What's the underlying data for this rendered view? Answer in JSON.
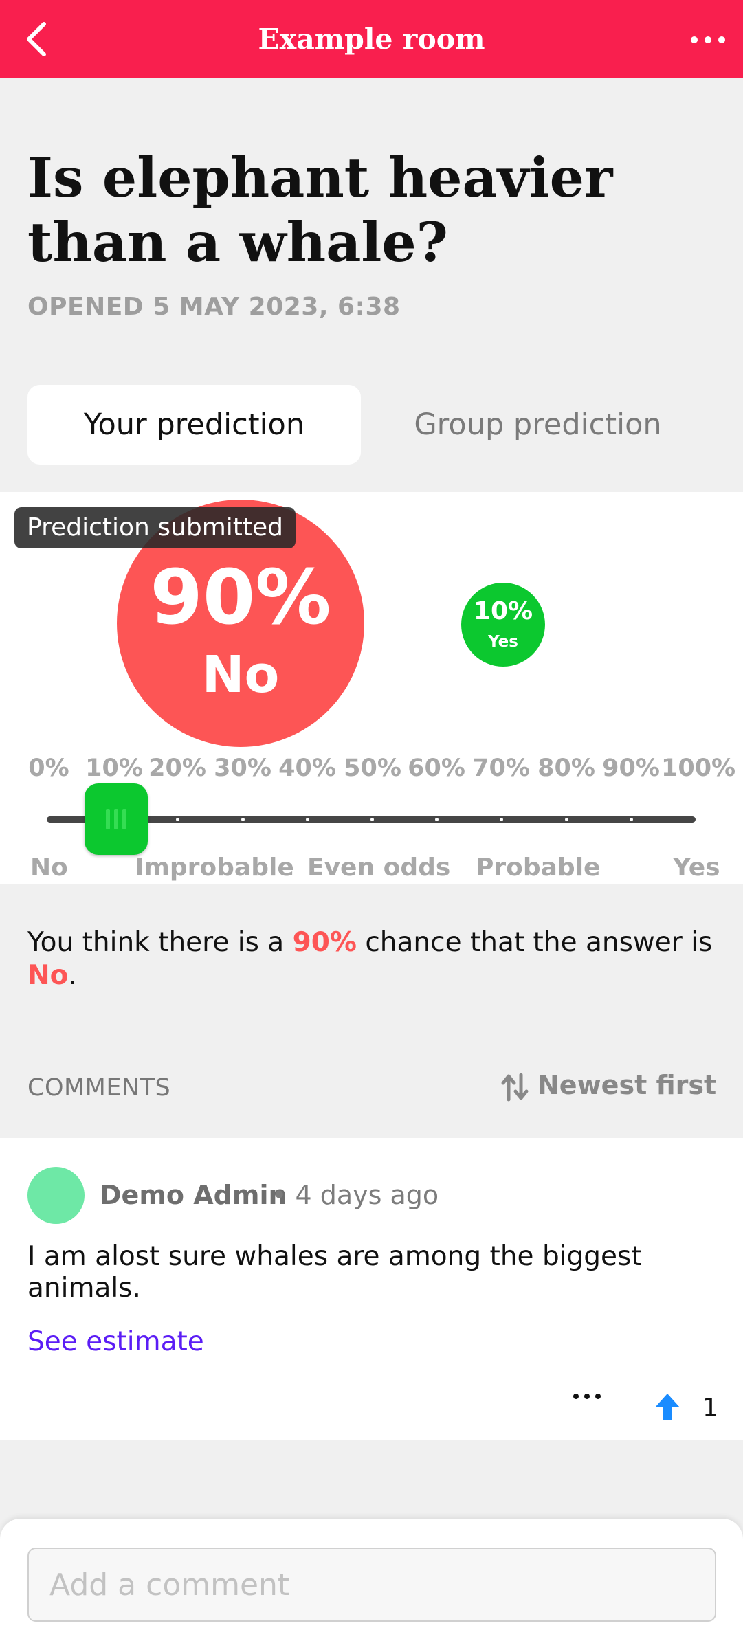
{
  "header": {
    "title": "Example room"
  },
  "question": {
    "title": "Is elephant heavier than a whale?",
    "opened": "OPENED 5 MAY 2023, 6:38"
  },
  "tabs": [
    {
      "label": "Your prediction",
      "active": true
    },
    {
      "label": "Group prediction",
      "active": false
    }
  ],
  "prediction": {
    "badge": "Prediction submitted",
    "primary": {
      "percent": "90%",
      "answer": "No",
      "color": "#fd5555"
    },
    "secondary": {
      "percent": "10%",
      "answer": "Yes",
      "color": "#0cc82f"
    },
    "slider": {
      "ticks": [
        "0%",
        "10%",
        "20%",
        "30%",
        "40%",
        "50%",
        "60%",
        "70%",
        "80%",
        "90%",
        "100%"
      ],
      "value_yes_percent": 10,
      "scale_labels": [
        "No",
        "Improbable",
        "Even odds",
        "Probable",
        "Yes"
      ]
    }
  },
  "summary": {
    "prefix": "You think there is a ",
    "percent": "90%",
    "middle": " chance that the answer is ",
    "answer": "No",
    "suffix": "."
  },
  "comments": {
    "heading": "COMMENTS",
    "sort_label": "Newest first",
    "items": [
      {
        "author": "Demo Admin",
        "meta": "• 4 days ago",
        "text": "I am alost sure whales are among the biggest animals.",
        "link": "See estimate",
        "upvotes": "1"
      }
    ]
  },
  "composer": {
    "placeholder": "Add a comment"
  },
  "colors": {
    "brand": "#f91f4e",
    "no": "#fd5555",
    "yes": "#0cc82f",
    "link": "#5b1df5",
    "upvote": "#1a8cff"
  }
}
